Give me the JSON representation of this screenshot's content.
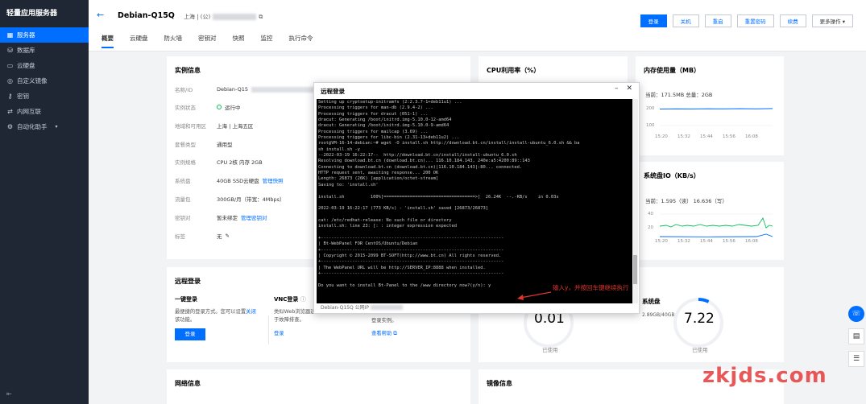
{
  "sidebar": {
    "brand": "轻量应用服务器",
    "items": [
      {
        "label": "服务器",
        "icon": "server-icon"
      },
      {
        "label": "数据库",
        "icon": "database-icon"
      },
      {
        "label": "云硬盘",
        "icon": "disk-icon"
      },
      {
        "label": "自定义镜像",
        "icon": "image-icon"
      },
      {
        "label": "密钥",
        "icon": "key-icon"
      },
      {
        "label": "内网互联",
        "icon": "network-icon"
      },
      {
        "label": "自动化助手",
        "icon": "automation-icon"
      }
    ],
    "bottom_icon": "collapse-icon"
  },
  "header": {
    "title": "Debian-Q15Q",
    "region": "上海 | (公)",
    "buttons": [
      "登录",
      "关机",
      "重启",
      "重置密码",
      "续费",
      "更多操作"
    ],
    "tabs": [
      "概要",
      "云硬盘",
      "防火墙",
      "密钥对",
      "快照",
      "监控",
      "执行命令"
    ]
  },
  "instance_info": {
    "title": "实例信息",
    "rows": [
      {
        "label": "名称/ID",
        "value": "Debian-Q15"
      },
      {
        "label": "实例状态",
        "value": "运行中"
      },
      {
        "label": "地域和可用区",
        "value": "上海 | 上海五区"
      },
      {
        "label": "套餐类型",
        "value": "通用型"
      },
      {
        "label": "实例规格",
        "value": "CPU 2核 内存 2GB"
      },
      {
        "label": "系统盘",
        "value": "40GB SSD云硬盘",
        "link": "管理快照"
      },
      {
        "label": "流量包",
        "value": "300GB/月（带宽：4Mbps）"
      },
      {
        "label": "密钥对",
        "value": "暂未绑定",
        "link": "管理密钥对"
      },
      {
        "label": "标签",
        "value": "无"
      }
    ]
  },
  "cpu": {
    "title": "CPU利用率（%）"
  },
  "memory": {
    "title": "内存使用量（MB）",
    "current": "当前：171.5MB 总量：2GB",
    "y_ticks": [
      "200",
      "100"
    ],
    "x_ticks": [
      "15:20",
      "15:32",
      "15:44",
      "15:56",
      "16:08"
    ]
  },
  "disk_io": {
    "title": "系统盘IO（KB/s）",
    "current": "当前：1.595（读） 16.636（写）",
    "y_ticks": [
      "40",
      "20"
    ],
    "x_ticks": [
      "15:20",
      "15:32",
      "15:44",
      "15:56",
      "16:08"
    ]
  },
  "remote_login": {
    "title": "远程登录",
    "one_click": {
      "title": "一键登录",
      "desc1": "最便捷的登录方式。您可以设置",
      "desc_link": "关闭",
      "desc2": "该功能。",
      "button": "登录"
    },
    "vnc": {
      "title": "VNC登录",
      "desc1": "类似Web浏览器远",
      "desc2": "于故障排查。",
      "link": "登录"
    },
    "other": {
      "desc": "登录实例。",
      "link": "查看帮助"
    }
  },
  "usage": {
    "left_value": "0.01",
    "left_sub": "已使用",
    "right_title": "系统盘",
    "right_capacity": "2.89GB/40GB",
    "right_value": "7.22",
    "right_sub": "已使用"
  },
  "network": {
    "title": "网络信息"
  },
  "mirror": {
    "title": "镜像信息"
  },
  "modal": {
    "title": "远程登录",
    "footer": "Debian-Q15Q 公网IP",
    "terminal_lines": [
      "Setting up cryptsetup-initramfs (2:2.3.7-1+deb11u1) ...",
      "Processing triggers for man-db (2.9.4-2) ...",
      "Processing triggers for dracut (051-1) ...",
      "dracut: Generating /boot/initrd.img-5.10.0-12-amd64",
      "dracut: Generating /boot/initrd.img-5.10.0-9-amd64",
      "Processing triggers for mailcap (3.69) ...",
      "Processing triggers for libc-bin (2.31-13+deb11u2) ...",
      "root@VM-16-14-debian:~# wget -O install.sh http://download.bt.cn/install/install-ubuntu_6.0.sh && ba",
      "sh install.sh -y",
      "--2022-03-19 16:22:17--  http://download.bt.cn/install/install-ubuntu_6.0.sh",
      "Resolving download.bt.cn (download.bt.cn)... 116.10.184.143, 240e:a5:4200:89::143",
      "Connecting to download.bt.cn (download.bt.cn)|116.10.184.143|:80... connected.",
      "HTTP request sent, awaiting response... 200 OK",
      "Length: 26873 (26K) [application/octet-stream]",
      "Saving to: 'install.sh'",
      "",
      "install.sh          100%[===================================>]  26.24K  --.-KB/s    in 0.03s",
      "",
      "2022-03-19 16:22:17 (773 KB/s) - 'install.sh' saved [26873/26873]",
      "",
      "cat: /etc/redhat-release: No such file or directory",
      "install.sh: line 23: [: : integer expression expected",
      "",
      "+----------------------------------------------------------------------",
      "| Bt-WebPanel FOR CentOS/Ubuntu/Debian",
      "+----------------------------------------------------------------------",
      "| Copyright © 2015-2099 BT-SOFT(http://www.bt.cn) All rights reserved.",
      "+----------------------------------------------------------------------",
      "| The WebPanel URL will be http://SERVER_IP:8888 when installed.",
      "+----------------------------------------------------------------------",
      "",
      "Do you want to install Bt-Panel to the /www directory now?(y/n): y"
    ]
  },
  "annotation": "输入y，并按回车键继续执行",
  "watermark": "zkjds.com",
  "colors": {
    "primary": "#006eff",
    "sidebar_bg": "#1f2735",
    "ok": "#0abf5b",
    "annotation": "#e0352b"
  }
}
